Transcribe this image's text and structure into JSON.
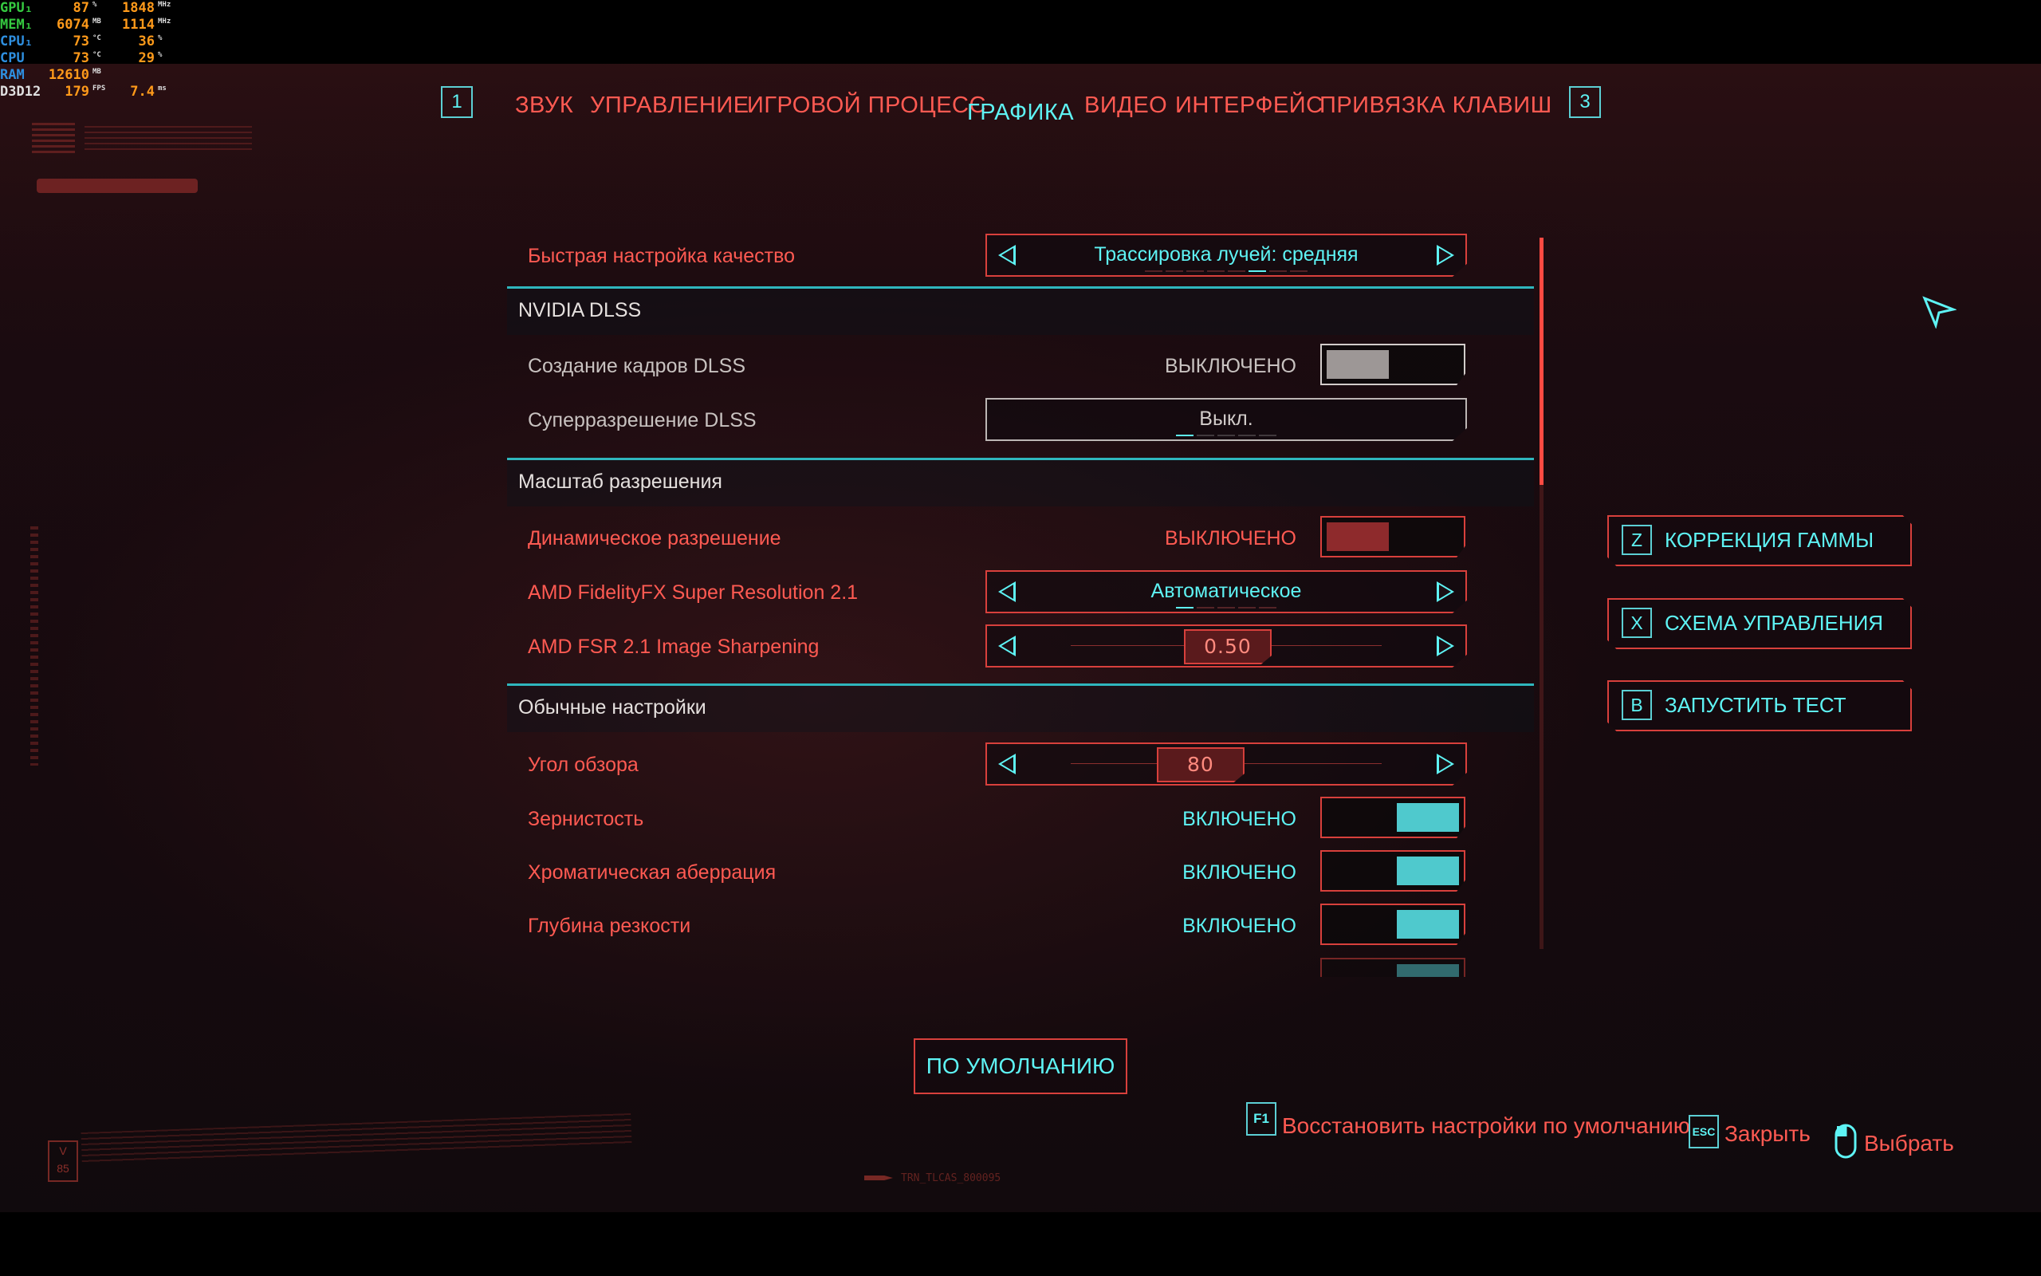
{
  "perf_overlay": [
    {
      "label": "GPU₁",
      "label_color": "#35c940",
      "v1": "87",
      "u1": "%",
      "v2": "1848",
      "u2": "MHz"
    },
    {
      "label": "MEM₁",
      "label_color": "#35c940",
      "v1": "6074",
      "u1": "MB",
      "v2": "1114",
      "u2": "MHz"
    },
    {
      "label": "CPU₁",
      "label_color": "#2e8fe0",
      "v1": "73",
      "u1": "°C",
      "v2": "36",
      "u2": "%"
    },
    {
      "label": "CPU",
      "label_color": "#2e8fe0",
      "v1": "73",
      "u1": "°C",
      "v2": "29",
      "u2": "%"
    },
    {
      "label": "RAM",
      "label_color": "#2e8fe0",
      "v1": "12610",
      "u1": "MB",
      "v2": "",
      "u2": ""
    },
    {
      "label": "D3D12",
      "label_color": "#e0e0e0",
      "v1": "179",
      "u1": "FPS",
      "v2": "7.4",
      "u2": "ms"
    }
  ],
  "nav": {
    "prev_key": "1",
    "next_key": "3",
    "tabs": [
      "ЗВУК",
      "УПРАВЛЕНИЕ",
      "ИГРОВОЙ ПРОЦЕСС",
      "ГРАФИКА",
      "ВИДЕО",
      "ИНТЕРФЕЙС",
      "ПРИВЯЗКА КЛАВИШ"
    ],
    "active_tab": "ГРАФИКА"
  },
  "settings": {
    "quick_preset": {
      "label": "Быстрая настройка качество",
      "value": "Трассировка лучей: средняя"
    },
    "section_dlss": "NVIDIA DLSS",
    "dlss_frame_gen": {
      "label": "Создание кадров DLSS",
      "state": "ВЫКЛЮЧЕНО"
    },
    "dlss_super_res": {
      "label": "Суперразрешение DLSS",
      "value": "Выкл."
    },
    "section_resolution": "Масштаб разрешения",
    "dynamic_res": {
      "label": "Динамическое разрешение",
      "state": "ВЫКЛЮЧЕНО"
    },
    "fsr": {
      "label": "AMD FidelityFX Super Resolution 2.1",
      "value": "Автоматическое"
    },
    "fsr_sharpening": {
      "label": "AMD FSR 2.1 Image Sharpening",
      "value": "0.50",
      "fraction": 0.5
    },
    "section_basic": "Обычные настройки",
    "fov": {
      "label": "Угол обзора",
      "value": "80",
      "fraction": 0.38
    },
    "film_grain": {
      "label": "Зернистость",
      "state": "ВКЛЮЧЕНО"
    },
    "chromatic": {
      "label": "Хроматическая аберрация",
      "state": "ВКЛЮЧЕНО"
    },
    "dof": {
      "label": "Глубина резкости",
      "state": "ВКЛЮЧЕНО"
    }
  },
  "side_buttons": [
    {
      "key": "Z",
      "label": "КОРРЕКЦИЯ ГАММЫ"
    },
    {
      "key": "X",
      "label": "СХЕМА УПРАВЛЕНИЯ"
    },
    {
      "key": "B",
      "label": "ЗАПУСТИТЬ ТЕСТ"
    }
  ],
  "defaults_button": "ПО УМОЛЧАНИЮ",
  "hints": {
    "restore_key": "F1",
    "restore_label": "Восстановить настройки по умолчанию",
    "close_key": "ESC",
    "close_label": "Закрыть",
    "select_label": "Выбрать"
  },
  "footer_code": "TRN_TLCAS_800095",
  "colors": {
    "accent_cyan": "#5ef3f4",
    "accent_red": "#ff5a52",
    "border_red": "#d8403c",
    "toggle_on": "#4fc9cd",
    "toggle_off_red": "#8e2a2c",
    "toggle_off_grey": "#9d9796"
  }
}
